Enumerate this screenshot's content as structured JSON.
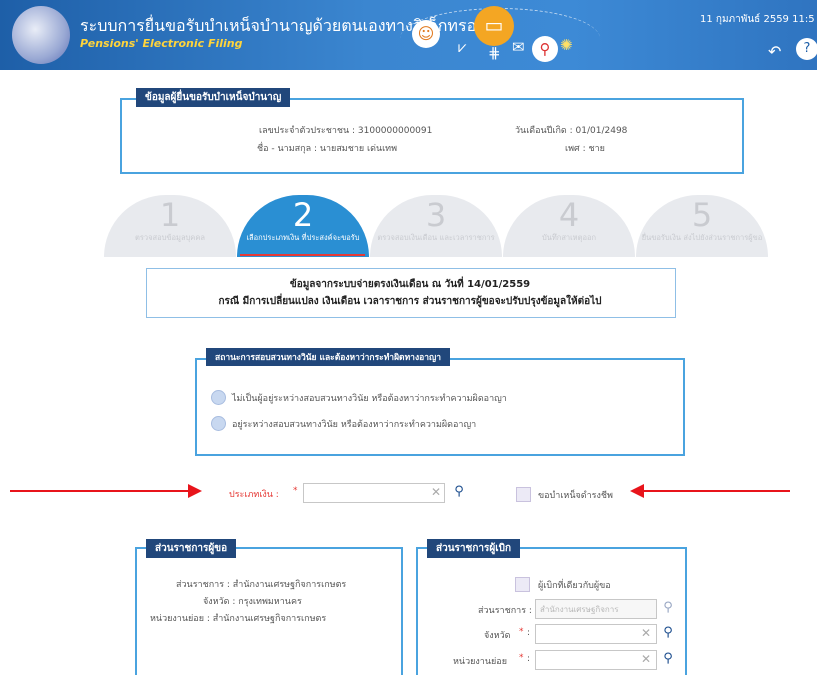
{
  "header": {
    "title_th": "ระบบการยื่นขอรับบำเหน็จบำนาญด้วยตนเองทางอิเล็กทรอนิกส์",
    "title_en": "Pensions' Electronic Filing",
    "date": "11 กุมภาพันธ์ 2559 11:5"
  },
  "applicant": {
    "panel_title": "ข้อมูลผู้ยื่นขอรับบำเหน็จบำนาญ",
    "id_card": "เลขประจำตัวประชาชน : 3100000000091",
    "name": "ชื่อ - นามสกุล : นายสมชาย เด่นเทพ",
    "birth_date": "วันเดือนปีเกิด : 01/01/2498",
    "gender": "เพศ : ชาย"
  },
  "steps": [
    {
      "number": "1",
      "label": "ตรวจสอบข้อมูลบุคคล"
    },
    {
      "number": "2",
      "label": "เลือกประเภทเงิน ที่ประสงค์จะขอรับ"
    },
    {
      "number": "3",
      "label": "ตรวจสอบเงินเดือน และเวลาราชการ"
    },
    {
      "number": "4",
      "label": "บันทึกสาเหตุออก"
    },
    {
      "number": "5",
      "label": "ยื่นขอรับเงิน ส่งไปยังส่วนราชการผู้ขอ"
    }
  ],
  "notice": {
    "line1": "ข้อมูลจากระบบจ่ายตรงเงินเดือน ณ วันที่ 14/01/2559",
    "line2": "กรณี มีการเปลี่ยนแปลง เงินเดือน เวลาราชการ ส่วนราชการผู้ขอจะปรับปรุงข้อมูลให้ต่อไป"
  },
  "investigation": {
    "panel_title": "สถานะการสอบสวนทางวินัย และต้องหาว่ากระทำผิดทางอาญา",
    "option1": "ไม่เป็นผู้อยู่ระหว่างสอบสวนทางวินัย หรือต้องหาว่ากระทำความผิดอาญา",
    "option2": "อยู่ระหว่างสอบสวนทางวินัย หรือต้องหาว่ากระทำความผิดอาญา"
  },
  "pension_type": {
    "label": "ประเภทเงิน :",
    "required_mark": "*",
    "value": "",
    "checkbox_label": "ขอบำเหน็จดำรงชีพ"
  },
  "requesting_agency": {
    "panel_title": "ส่วนราชการผู้ขอ",
    "agency": "ส่วนราชการ : สำนักงานเศรษฐกิจการเกษตร",
    "province": "จังหวัด : กรุงเทพมหานคร",
    "sub_unit": "หน่วยงานย่อย : สำนักงานเศรษฐกิจการเกษตร"
  },
  "paying_agency": {
    "panel_title": "ส่วนราชการผู้เบิก",
    "same_label": "ผู้เบิกที่เดียวกับผู้ขอ",
    "agency_label": "ส่วนราชการ :",
    "agency_value": "สำนักงานเศรษฐกิจการ",
    "province_label": "จังหวัด",
    "sub_unit_label": "หน่วยงานย่อย",
    "required_mark": "*",
    "colon": ":"
  },
  "icons": {
    "search": "search-icon",
    "clear": "clear-icon",
    "back": "back-arrow-icon",
    "help": "help-icon"
  },
  "colors": {
    "header": "#2f74c0",
    "panel_border": "#4aa3df",
    "panel_title_bg": "#21477b",
    "step_active": "#2a8fd3",
    "arrow": "#e8141b",
    "required": "#e53935"
  }
}
